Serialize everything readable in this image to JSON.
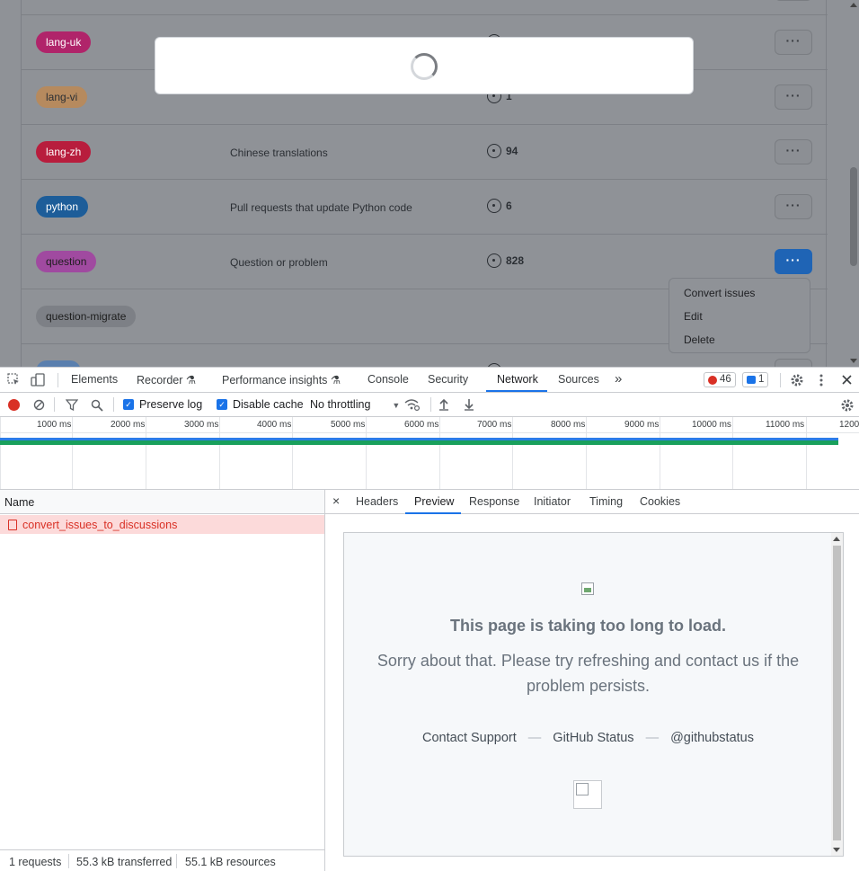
{
  "page": {
    "labels": [
      {
        "name": "lang-uk",
        "color": "#b0246a",
        "description": "",
        "count": ""
      },
      {
        "name": "lang-vi",
        "color": "#b68a5e",
        "text_color": "#2b2f34",
        "description": "",
        "count": "1"
      },
      {
        "name": "lang-zh",
        "color": "#b81d3d",
        "description": "Chinese translations",
        "count": "94"
      },
      {
        "name": "python",
        "color": "#1d5d99",
        "description": "Pull requests that update Python code",
        "count": "6"
      },
      {
        "name": "question",
        "color": "#a04aa0",
        "text_color": "#1d1d1d",
        "description": "Question or problem",
        "count": "828"
      },
      {
        "name": "question-migrate",
        "color": "#7d8086",
        "text_color": "#1d1d1d",
        "description": "",
        "count": ""
      }
    ],
    "actions_glyph": "···",
    "menu": [
      "Convert issues",
      "Edit",
      "Delete"
    ]
  },
  "devtools": {
    "tabs": [
      "Elements",
      "Recorder",
      "Performance insights",
      "Console",
      "Security",
      "Network",
      "Sources"
    ],
    "active_tab": "Network",
    "more_glyph": "»",
    "errors": "46",
    "messages": "1",
    "toolbar": {
      "preserve_log": "Preserve log",
      "disable_cache": "Disable cache",
      "throttling": "No throttling"
    },
    "timeline": {
      "ticks": [
        "1000 ms",
        "2000 ms",
        "3000 ms",
        "4000 ms",
        "5000 ms",
        "6000 ms",
        "7000 ms",
        "8000 ms",
        "9000 ms",
        "10000 ms",
        "11000 ms",
        "1200"
      ]
    },
    "requests": {
      "column": "Name",
      "rows": [
        "convert_issues_to_discussions"
      ],
      "status": [
        "1 requests",
        "55.3 kB transferred",
        "55.1 kB resources"
      ]
    },
    "detail": {
      "close": "×",
      "tabs": [
        "Headers",
        "Preview",
        "Response",
        "Initiator",
        "Timing",
        "Cookies"
      ],
      "active_tab": "Preview",
      "preview": {
        "title": "This page is taking too long to load.",
        "body": "Sorry about that. Please try refreshing and contact us if the problem persists.",
        "links": [
          "Contact Support",
          "GitHub Status",
          "@githubstatus"
        ],
        "separator": "—"
      }
    }
  }
}
